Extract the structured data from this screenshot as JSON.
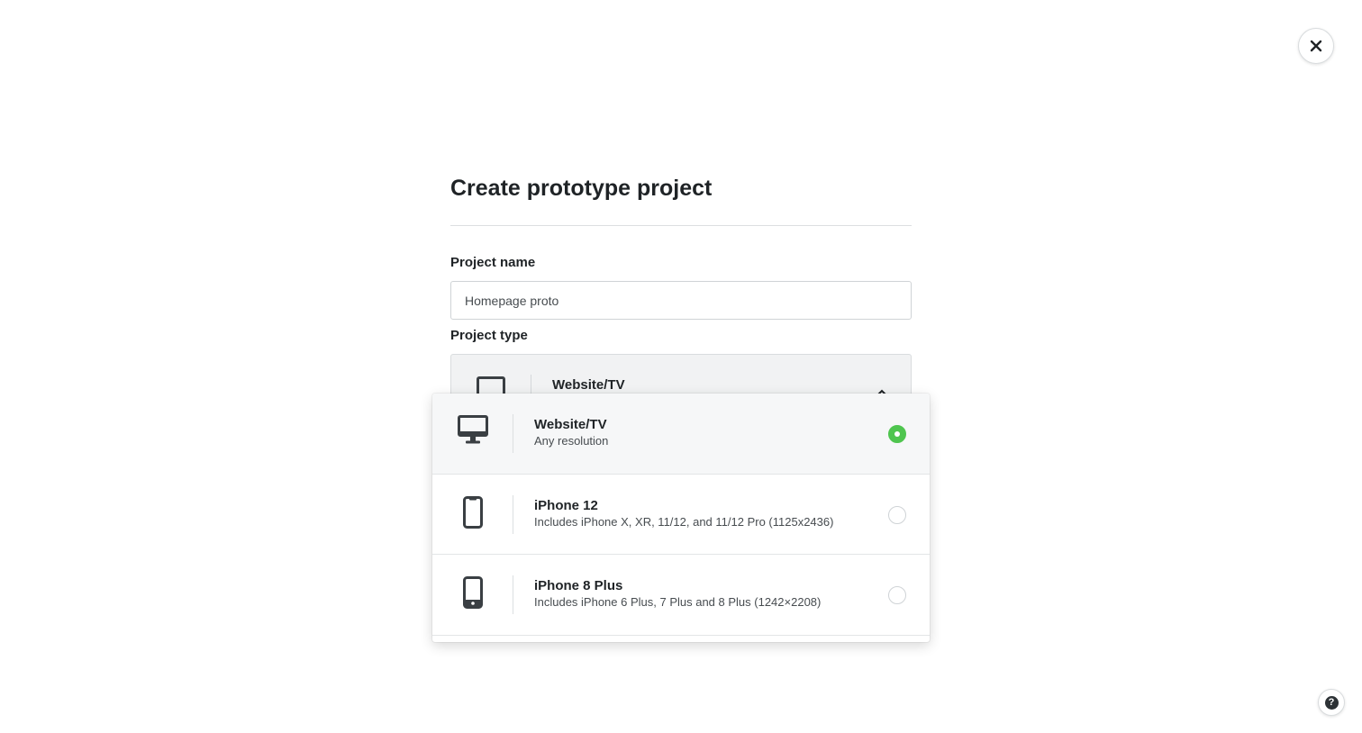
{
  "page": {
    "title": "Create prototype project"
  },
  "form": {
    "project_name_label": "Project name",
    "project_name_value": "Homepage proto",
    "project_type_label": "Project type",
    "selected_type": "Website/TV"
  },
  "options": [
    {
      "title": "Website/TV",
      "subtitle": "Any resolution",
      "icon": "monitor-icon",
      "selected": true
    },
    {
      "title": "iPhone 12",
      "subtitle": "Includes iPhone X, XR, 11/12, and 11/12 Pro (1125x2436)",
      "icon": "iphone-notch-icon",
      "selected": false
    },
    {
      "title": "iPhone 8 Plus",
      "subtitle": "Includes iPhone 6 Plus, 7 Plus and 8 Plus (1242×2208)",
      "icon": "iphone-home-button-icon",
      "selected": false
    }
  ],
  "help": {
    "glyph": "?"
  },
  "colors": {
    "accent_green": "#4fc54f",
    "text_dark": "#1f2326",
    "text_muted": "#474c50"
  }
}
